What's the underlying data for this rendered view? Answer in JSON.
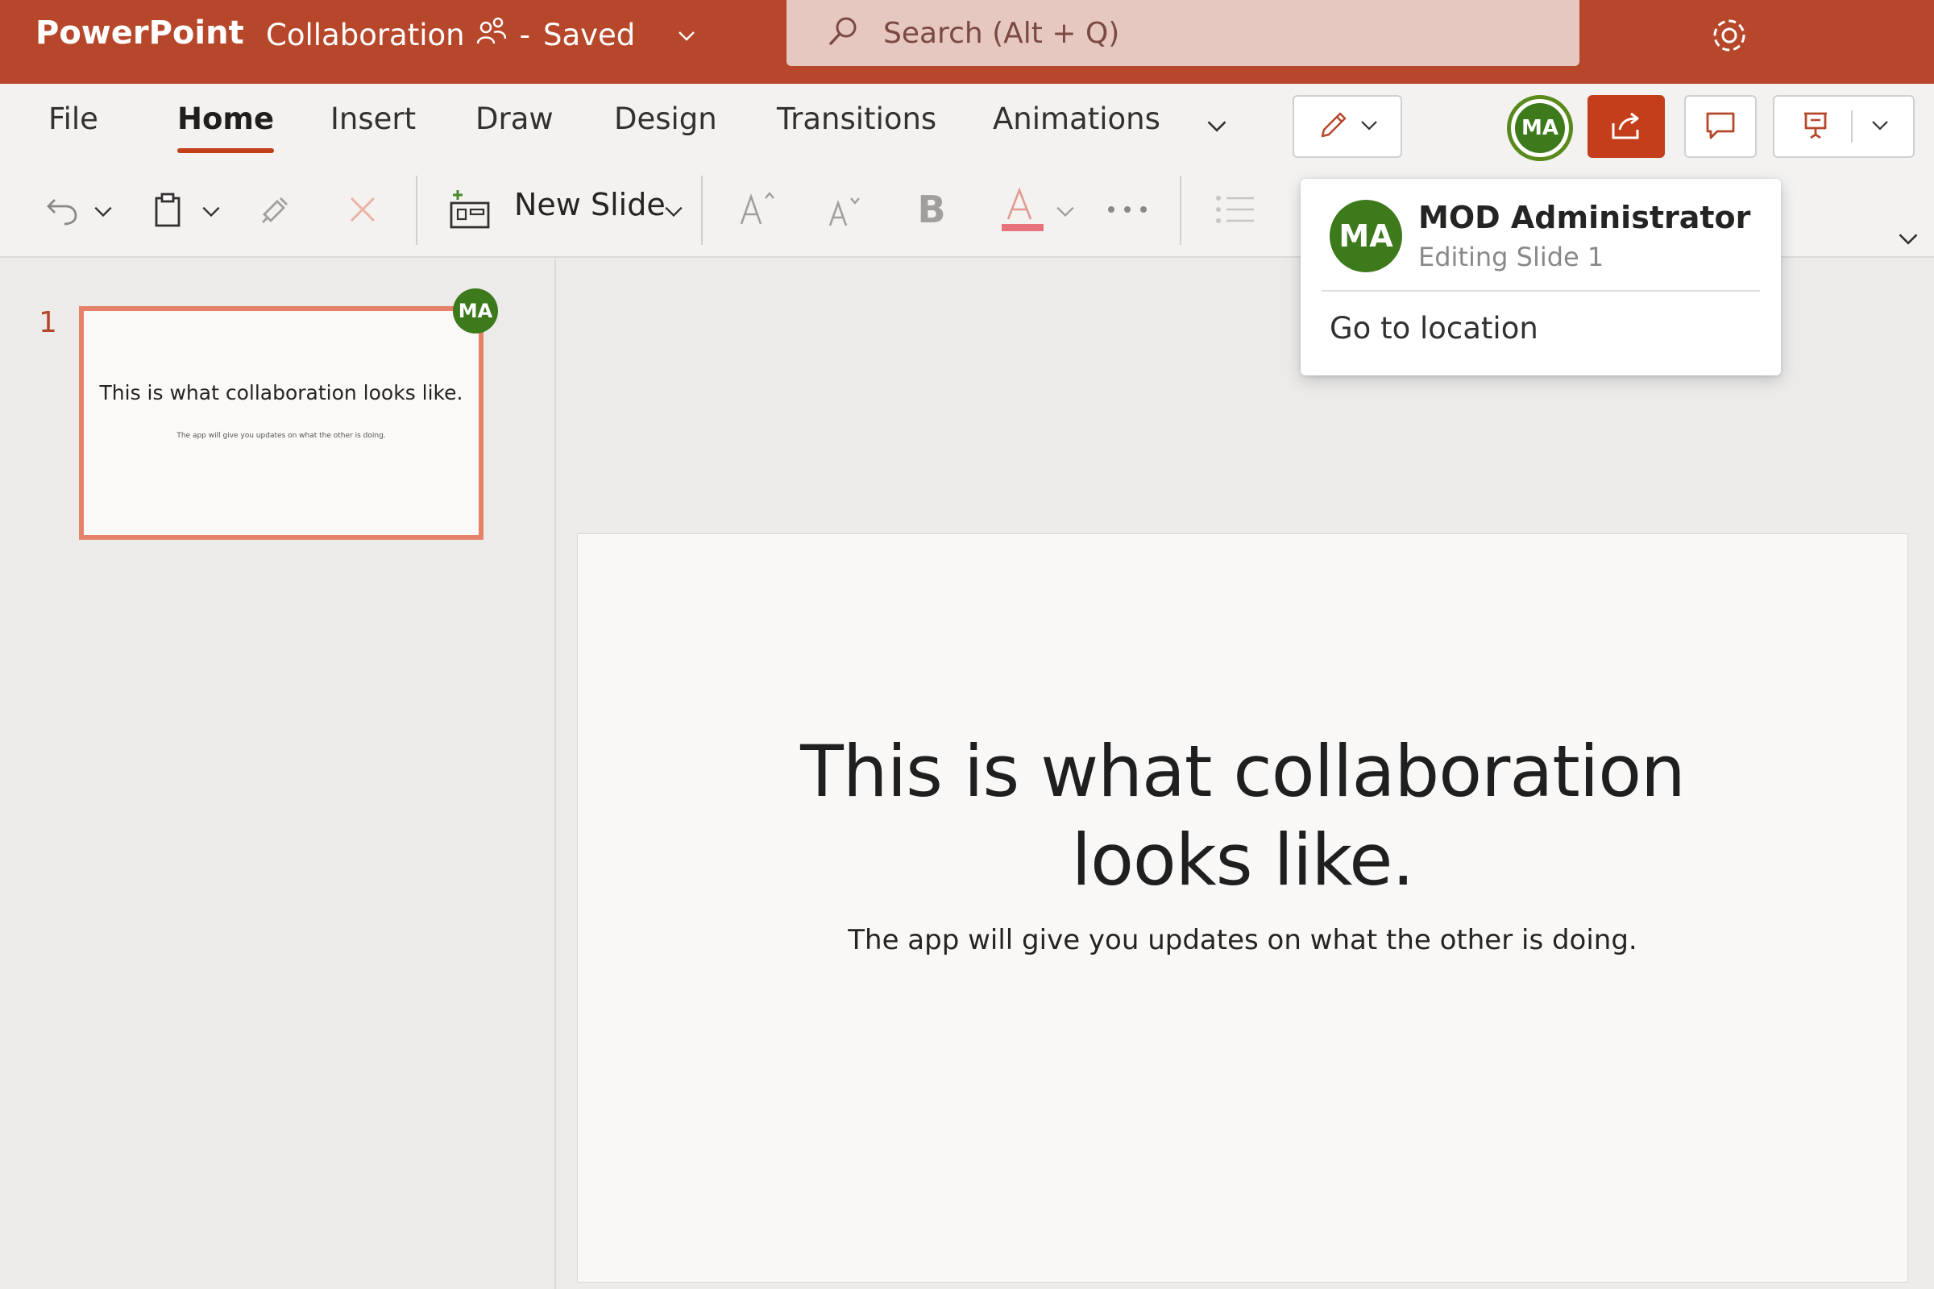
{
  "app": {
    "name": "PowerPoint",
    "document_title": "Collaboration",
    "status_separator": "-",
    "save_status": "Saved"
  },
  "search": {
    "placeholder": "Search (Alt + Q)"
  },
  "ribbon": {
    "tabs": [
      "File",
      "Home",
      "Insert",
      "Draw",
      "Design",
      "Transitions",
      "Animations"
    ],
    "active_tab": "Home",
    "new_slide_label": "New Slide",
    "font_color_accent": "#e8737c"
  },
  "collaborator": {
    "initials": "MA",
    "name": "MOD Administrator",
    "status": "Editing Slide 1",
    "go_to_location_label": "Go to location",
    "color": "#3c7a1b"
  },
  "slides": [
    {
      "number": "1",
      "title": "This is what collaboration looks like.",
      "title_line1": "This is what collaboration",
      "title_line2": "looks like.",
      "subtitle": "The app will give you updates on what the other is doing.",
      "editor_initials": "MA"
    }
  ],
  "colors": {
    "title_bar": "#b7472a",
    "accent": "#c43e1c",
    "thumbnail_border": "#e6816a"
  }
}
